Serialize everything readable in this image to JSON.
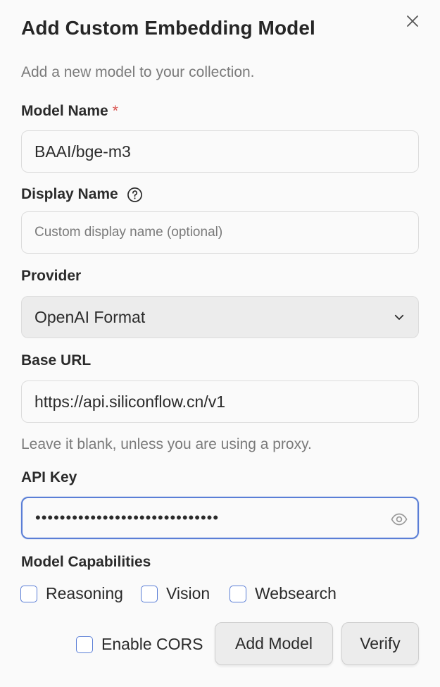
{
  "dialog": {
    "title": "Add Custom Embedding Model",
    "subtitle": "Add a new model to your collection.",
    "close_icon": "close-icon"
  },
  "fields": {
    "model_name": {
      "label": "Model Name",
      "required_mark": "*",
      "value": "BAAI/bge-m3"
    },
    "display_name": {
      "label": "Display Name",
      "help_icon": "question-circle-icon",
      "value": "",
      "placeholder": "Custom display name (optional)"
    },
    "provider": {
      "label": "Provider",
      "selected": "OpenAI Format",
      "chevron_icon": "chevron-down-icon"
    },
    "base_url": {
      "label": "Base URL",
      "value": "https://api.siliconflow.cn/v1",
      "hint": "Leave it blank, unless you are using a proxy."
    },
    "api_key": {
      "label": "API Key",
      "masked_value": "••••••••••••••••••••••••••••••",
      "eye_icon": "eye-icon"
    }
  },
  "capabilities": {
    "label": "Model Capabilities",
    "items": [
      {
        "label": "Reasoning",
        "checked": false
      },
      {
        "label": "Vision",
        "checked": false
      },
      {
        "label": "Websearch",
        "checked": false
      }
    ]
  },
  "footer": {
    "enable_cors": {
      "label": "Enable CORS",
      "checked": false
    },
    "add_model_label": "Add Model",
    "verify_label": "Verify"
  },
  "colors": {
    "accent": "#5a7ed6",
    "required": "#d9534f",
    "muted_text": "#7a7a7a",
    "background": "#fafafa"
  }
}
